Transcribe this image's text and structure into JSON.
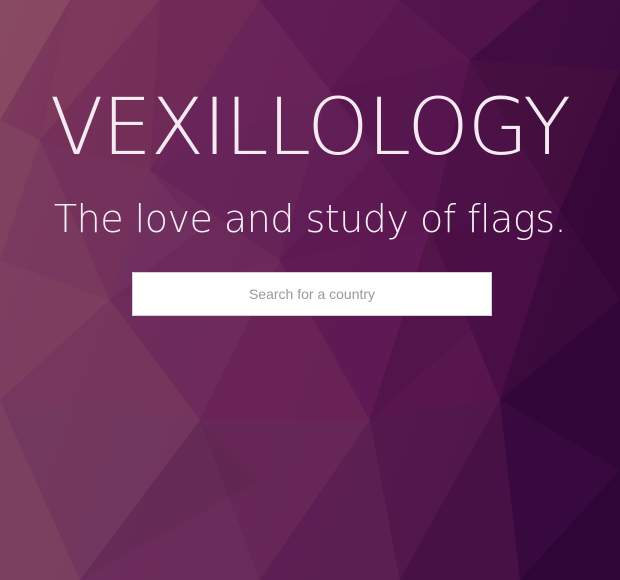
{
  "page": {
    "title": "VEXILLOLOGY",
    "subtitle": "The love and study of flags."
  },
  "search": {
    "placeholder": "Search for a country",
    "value": ""
  },
  "theme": {
    "background_start": "#7b3a5a",
    "background_end": "#2e0636",
    "text": "#f5eaf2",
    "input_background": "#ffffff",
    "placeholder_color": "#9a9a9a"
  }
}
